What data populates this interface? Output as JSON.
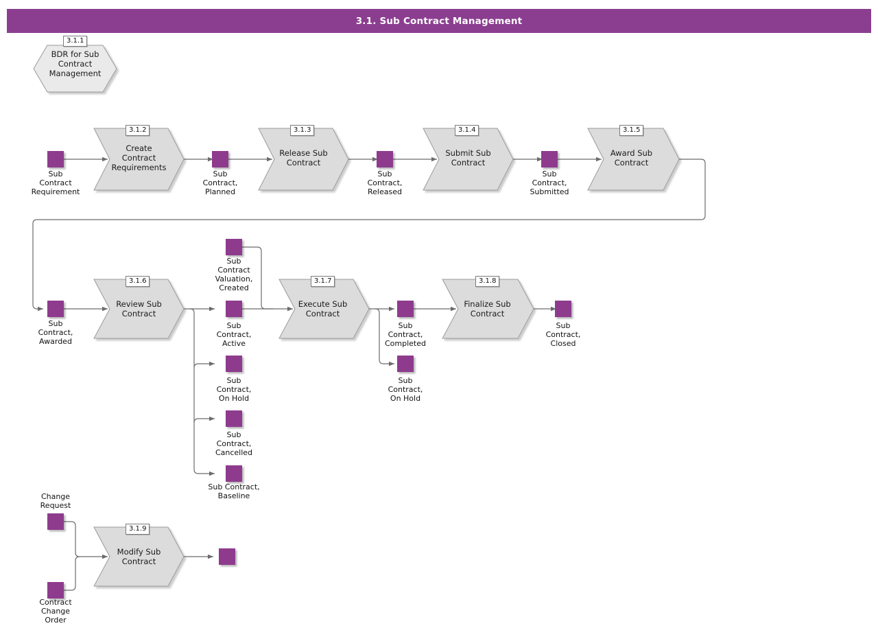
{
  "header": {
    "title": "3.1. Sub Contract Management"
  },
  "colors": {
    "header_purple": "#8B3E8F",
    "node_purple": "#8E3B8E",
    "process_fill": "#DCDCDC",
    "process_stroke": "#9A9A9A",
    "connector": "#6B6B6B",
    "label_text": "#111111"
  },
  "start_event": {
    "number": "3.1.1",
    "label": "BDR for Sub\nContract\nManagement",
    "shape": "hexagon"
  },
  "processes": [
    {
      "id": "p312",
      "number": "3.1.2",
      "label": "Create\nContract\nRequirements"
    },
    {
      "id": "p313",
      "number": "3.1.3",
      "label": "Release Sub\nContract"
    },
    {
      "id": "p314",
      "number": "3.1.4",
      "label": "Submit Sub\nContract"
    },
    {
      "id": "p315",
      "number": "3.1.5",
      "label": "Award Sub\nContract"
    },
    {
      "id": "p316",
      "number": "3.1.6",
      "label": "Review Sub\nContract"
    },
    {
      "id": "p317",
      "number": "3.1.7",
      "label": "Execute Sub\nContract"
    },
    {
      "id": "p318",
      "number": "3.1.8",
      "label": "Finalize Sub\nContract"
    },
    {
      "id": "p319",
      "number": "3.1.9",
      "label": "Modify Sub\nContract"
    }
  ],
  "data_objects": [
    {
      "id": "d1",
      "label": "Sub\nContract\nRequirement"
    },
    {
      "id": "d2",
      "label": "Sub\nContract,\nPlanned"
    },
    {
      "id": "d3",
      "label": "Sub\nContract,\nReleased"
    },
    {
      "id": "d4",
      "label": "Sub\nContract,\nSubmitted"
    },
    {
      "id": "d5",
      "label": "Sub\nContract,\nAwarded"
    },
    {
      "id": "d6",
      "label": "Sub\nContract\nValuation,\nCreated"
    },
    {
      "id": "d7",
      "label": "Sub\nContract,\nActive"
    },
    {
      "id": "d8",
      "label": "Sub\nContract,\nOn Hold"
    },
    {
      "id": "d9",
      "label": "Sub\nContract,\nCancelled"
    },
    {
      "id": "d10",
      "label": "Sub Contract,\nBaseline"
    },
    {
      "id": "d11",
      "label": "Sub\nContract,\nCompleted"
    },
    {
      "id": "d12",
      "label": "Sub\nContract,\nOn Hold"
    },
    {
      "id": "d13",
      "label": "Sub\nContract,\nClosed"
    },
    {
      "id": "d14",
      "label": "Change\nRequest"
    },
    {
      "id": "d15",
      "label": "Contract\nChange\nOrder"
    },
    {
      "id": "d16",
      "label": ""
    }
  ]
}
